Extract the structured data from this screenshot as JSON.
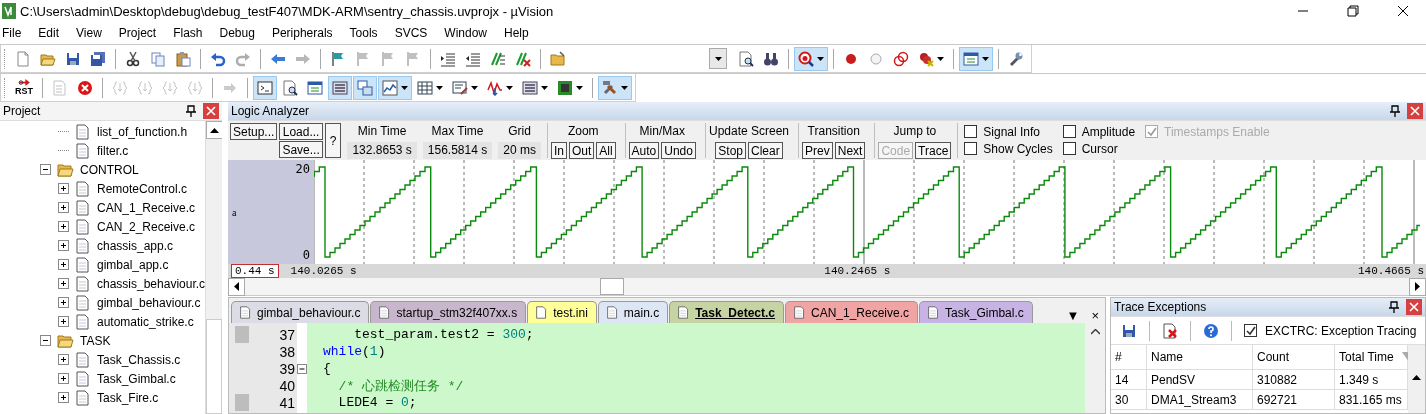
{
  "window": {
    "title": "C:\\Users\\admin\\Desktop\\debug\\debug_testF407\\MDK-ARM\\sentry_chassis.uvprojx - µVision"
  },
  "menu": [
    "File",
    "Edit",
    "View",
    "Project",
    "Flash",
    "Debug",
    "Peripherals",
    "Tools",
    "SVCS",
    "Window",
    "Help"
  ],
  "toolbar_1": [
    {
      "kind": "button",
      "on": false,
      "disabled": false,
      "dropdown": false
    },
    {
      "kind": "button",
      "on": false,
      "disabled": false,
      "dropdown": false
    },
    {
      "kind": "button",
      "on": false,
      "disabled": false,
      "dropdown": false
    },
    {
      "kind": "button",
      "on": false,
      "disabled": false,
      "dropdown": false
    },
    {
      "kind": "separator"
    },
    {
      "kind": "button",
      "on": false,
      "disabled": false,
      "dropdown": false
    },
    {
      "kind": "button",
      "on": false,
      "disabled": false,
      "dropdown": false
    },
    {
      "kind": "button",
      "on": false,
      "disabled": false,
      "dropdown": false
    },
    {
      "kind": "separator"
    },
    {
      "kind": "button",
      "on": false,
      "disabled": false,
      "dropdown": false
    },
    {
      "kind": "button",
      "on": false,
      "disabled": true,
      "dropdown": false
    },
    {
      "kind": "separator"
    },
    {
      "kind": "button",
      "on": false,
      "disabled": false,
      "dropdown": false
    },
    {
      "kind": "button",
      "on": false,
      "disabled": true,
      "dropdown": false
    },
    {
      "kind": "separator"
    },
    {
      "kind": "button",
      "on": false,
      "disabled": false,
      "dropdown": false
    },
    {
      "kind": "button",
      "on": false,
      "disabled": true,
      "dropdown": false
    },
    {
      "kind": "button",
      "on": false,
      "disabled": true,
      "dropdown": false
    },
    {
      "kind": "button",
      "on": false,
      "disabled": true,
      "dropdown": false
    },
    {
      "kind": "separator"
    },
    {
      "kind": "button",
      "on": false,
      "disabled": false,
      "dropdown": false
    },
    {
      "kind": "button",
      "on": false,
      "disabled": false,
      "dropdown": false
    },
    {
      "kind": "button",
      "on": false,
      "disabled": false,
      "dropdown": false
    },
    {
      "kind": "button",
      "on": false,
      "disabled": false,
      "dropdown": false
    },
    {
      "kind": "separator"
    },
    {
      "kind": "button",
      "on": false,
      "disabled": false,
      "dropdown": false
    },
    {
      "kind": "combo"
    },
    {
      "kind": "button",
      "on": false,
      "disabled": false,
      "dropdown": false
    },
    {
      "kind": "button",
      "on": false,
      "disabled": false,
      "dropdown": false
    },
    {
      "kind": "separator"
    },
    {
      "kind": "button",
      "on": true,
      "disabled": false,
      "dropdown": true
    },
    {
      "kind": "separator"
    },
    {
      "kind": "button",
      "on": false,
      "disabled": false,
      "dropdown": false
    },
    {
      "kind": "button",
      "on": false,
      "disabled": false,
      "dropdown": false
    },
    {
      "kind": "button",
      "on": false,
      "disabled": false,
      "dropdown": false
    },
    {
      "kind": "button",
      "on": false,
      "disabled": false,
      "dropdown": true
    },
    {
      "kind": "separator"
    },
    {
      "kind": "button",
      "on": true,
      "disabled": false,
      "dropdown": true
    },
    {
      "kind": "separator"
    },
    {
      "kind": "button",
      "on": false,
      "disabled": false,
      "dropdown": false
    }
  ],
  "toolbar_2": [
    {
      "kind": "button",
      "text": "RST",
      "on": false,
      "disabled": false,
      "dropdown": false
    },
    {
      "kind": "separator"
    },
    {
      "kind": "button",
      "on": false,
      "disabled": true,
      "dropdown": false
    },
    {
      "kind": "button",
      "on": false,
      "disabled": false,
      "dropdown": false
    },
    {
      "kind": "separator"
    },
    {
      "kind": "button",
      "on": false,
      "disabled": true,
      "dropdown": false
    },
    {
      "kind": "button",
      "on": false,
      "disabled": true,
      "dropdown": false
    },
    {
      "kind": "button",
      "on": false,
      "disabled": true,
      "dropdown": false
    },
    {
      "kind": "button",
      "on": false,
      "disabled": true,
      "dropdown": false
    },
    {
      "kind": "separator"
    },
    {
      "kind": "button",
      "on": false,
      "disabled": true,
      "dropdown": false
    },
    {
      "kind": "separator"
    },
    {
      "kind": "button",
      "on": true,
      "disabled": false,
      "dropdown": false
    },
    {
      "kind": "button",
      "on": false,
      "disabled": false,
      "dropdown": false
    },
    {
      "kind": "button",
      "on": false,
      "disabled": false,
      "dropdown": false
    },
    {
      "kind": "button",
      "on": true,
      "disabled": false,
      "dropdown": false
    },
    {
      "kind": "button",
      "on": true,
      "disabled": false,
      "dropdown": false
    },
    {
      "kind": "button",
      "on": true,
      "disabled": false,
      "dropdown": true
    },
    {
      "kind": "button",
      "on": false,
      "disabled": false,
      "dropdown": true
    },
    {
      "kind": "button",
      "on": false,
      "disabled": false,
      "dropdown": true
    },
    {
      "kind": "button",
      "on": false,
      "disabled": false,
      "dropdown": true
    },
    {
      "kind": "button",
      "on": false,
      "disabled": false,
      "dropdown": true
    },
    {
      "kind": "button",
      "on": false,
      "disabled": false,
      "dropdown": true
    },
    {
      "kind": "separator"
    },
    {
      "kind": "button",
      "on": true,
      "disabled": false,
      "dropdown": true
    }
  ],
  "project": {
    "title": "Project",
    "tree": [
      {
        "kind": "file",
        "label": "list_of_function.h"
      },
      {
        "kind": "file",
        "label": "filter.c"
      },
      {
        "kind": "folder",
        "label": "CONTROL",
        "expanded": true,
        "children": [
          {
            "kind": "file",
            "label": "RemoteControl.c",
            "expanded": false
          },
          {
            "kind": "file",
            "label": "CAN_1_Receive.c",
            "expanded": false
          },
          {
            "kind": "file",
            "label": "CAN_2_Receive.c",
            "expanded": false
          },
          {
            "kind": "file",
            "label": "chassis_app.c",
            "expanded": false
          },
          {
            "kind": "file",
            "label": "gimbal_app.c",
            "expanded": false
          },
          {
            "kind": "file",
            "label": "chassis_behaviour.c",
            "expanded": false
          },
          {
            "kind": "file",
            "label": "gimbal_behaviour.c",
            "expanded": false
          },
          {
            "kind": "file",
            "label": "automatic_strike.c",
            "expanded": false
          }
        ]
      },
      {
        "kind": "folder",
        "label": "TASK",
        "expanded": true,
        "children": [
          {
            "kind": "file",
            "label": "Task_Chassis.c",
            "expanded": false
          },
          {
            "kind": "file",
            "label": "Task_Gimbal.c",
            "expanded": false
          },
          {
            "kind": "file",
            "label": "Task_Fire.c",
            "expanded": false
          }
        ]
      }
    ]
  },
  "logic_analyzer": {
    "title": "Logic Analyzer",
    "file_buttons": [
      "Setup...",
      "Load...",
      "Save...",
      "?"
    ],
    "fields": [
      {
        "label": "Min Time",
        "value": "132.8653 s"
      },
      {
        "label": "Max Time",
        "value": "156.5814 s"
      },
      {
        "label": "Grid",
        "value": "20 ms"
      }
    ],
    "groups": [
      {
        "label": "Zoom",
        "buttons": [
          {
            "label": "In",
            "disabled": false
          },
          {
            "label": "Out",
            "disabled": false
          },
          {
            "label": "All",
            "disabled": false
          }
        ]
      },
      {
        "label": "Min/Max",
        "buttons": [
          {
            "label": "Auto",
            "disabled": false
          },
          {
            "label": "Undo",
            "disabled": false
          }
        ]
      },
      {
        "label": "Update Screen",
        "buttons": [
          {
            "label": "Stop",
            "disabled": false
          },
          {
            "label": "Clear",
            "disabled": false
          }
        ]
      },
      {
        "label": "Transition",
        "buttons": [
          {
            "label": "Prev",
            "disabled": false
          },
          {
            "label": "Next",
            "disabled": false
          }
        ]
      },
      {
        "label": "Jump to",
        "buttons": [
          {
            "label": "Code",
            "disabled": true
          },
          {
            "label": "Trace",
            "disabled": false
          }
        ]
      }
    ],
    "options": [
      {
        "label": "Signal Info",
        "checked": false,
        "disabled": false
      },
      {
        "label": "Show Cycles",
        "checked": false,
        "disabled": false
      },
      {
        "label": "Amplitude",
        "checked": false,
        "disabled": false
      },
      {
        "label": "Cursor",
        "checked": false,
        "disabled": false
      },
      {
        "label": "Timestamps Enable",
        "checked": true,
        "disabled": true
      }
    ],
    "signal": {
      "name": "a",
      "max": "20",
      "min": "0"
    },
    "range": "0.44 s",
    "time_labels": [
      "140.0265 s",
      "140.2465 s",
      "140.4665 s"
    ]
  },
  "editor": {
    "tabs": [
      {
        "label": "gimbal_behaviour.c",
        "color": "#dcdce6",
        "selected": false
      },
      {
        "label": "startup_stm32f407xx.s",
        "color": "#c8b6cc",
        "selected": false
      },
      {
        "label": "test.ini",
        "color": "#ffff99",
        "selected": false
      },
      {
        "label": "main.c",
        "color": "#dce6f4",
        "selected": false
      },
      {
        "label": "Task_Detect.c",
        "color": "#c6d4a4",
        "selected": true
      },
      {
        "label": "CAN_1_Receive.c",
        "color": "#f0a4a4",
        "selected": false
      },
      {
        "label": "Task_Gimbal.c",
        "color": "#c8b4e4",
        "selected": false
      }
    ],
    "list_glyph": "▼",
    "close_glyph": "×",
    "lines": [
      {
        "number": "37",
        "marker": true,
        "foldable": false,
        "tokens": [
          {
            "kind": "plain",
            "text": "    test_param.test2 = "
          },
          {
            "kind": "number",
            "text": "300"
          },
          {
            "kind": "plain",
            "text": ";"
          }
        ]
      },
      {
        "number": "38",
        "marker": false,
        "foldable": false,
        "tokens": [
          {
            "kind": "keyword",
            "text": "while"
          },
          {
            "kind": "plain",
            "text": "("
          },
          {
            "kind": "number",
            "text": "1"
          },
          {
            "kind": "plain",
            "text": ")"
          }
        ]
      },
      {
        "number": "39",
        "marker": false,
        "foldable": true,
        "tokens": [
          {
            "kind": "plain",
            "text": "{"
          }
        ]
      },
      {
        "number": "40",
        "marker": false,
        "foldable": false,
        "tokens": [
          {
            "kind": "comment",
            "text": "  /* 心跳检测任务 */"
          }
        ]
      },
      {
        "number": "41",
        "marker": true,
        "foldable": false,
        "tokens": [
          {
            "kind": "plain",
            "text": "  LEDE4 = "
          },
          {
            "kind": "number",
            "text": "0"
          },
          {
            "kind": "plain",
            "text": ";"
          }
        ]
      }
    ]
  },
  "trace_exceptions": {
    "title": "Trace Exceptions",
    "tracing": {
      "label": "EXCTRC: Exception Tracing",
      "checked": true
    },
    "columns": [
      "#",
      "Name",
      "Count",
      "Total Time"
    ],
    "rows": [
      [
        "14",
        "PendSV",
        "310882",
        "1.349 s"
      ],
      [
        "30",
        "DMA1_Stream3",
        "692721",
        "831.165 ms"
      ]
    ]
  }
}
